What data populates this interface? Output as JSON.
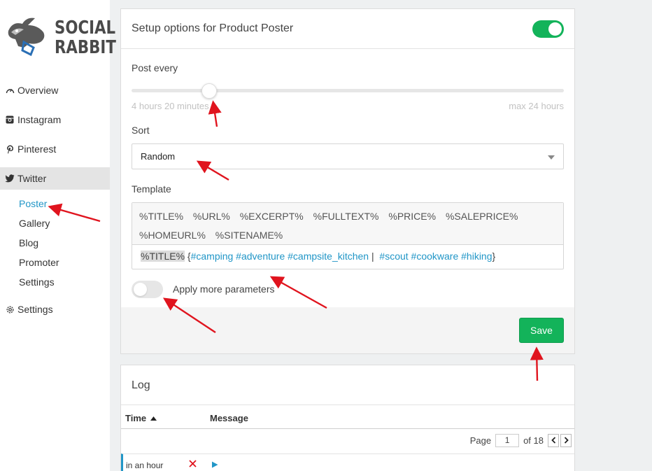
{
  "brand": {
    "line1": "SOCIAL",
    "line2": "RABBIT"
  },
  "sidebar": {
    "items": [
      {
        "label": "Overview",
        "icon": "dashboard-icon"
      },
      {
        "label": "Instagram",
        "icon": "instagram-icon"
      },
      {
        "label": "Pinterest",
        "icon": "pinterest-icon"
      },
      {
        "label": "Twitter",
        "icon": "twitter-icon"
      }
    ],
    "twitter_sub": [
      "Poster",
      "Gallery",
      "Blog",
      "Promoter",
      "Settings"
    ],
    "settings": {
      "label": "Settings",
      "icon": "gear-icon"
    }
  },
  "setup": {
    "title": "Setup options for Product Poster",
    "enabled": true,
    "post_every_label": "Post every",
    "post_every_value": "4 hours 20 minutes",
    "post_every_fraction": 0.18,
    "post_every_max": "max 24 hours",
    "sort_label": "Sort",
    "sort_value": "Random",
    "template_label": "Template",
    "tags": [
      "%TITLE%",
      "%URL%",
      "%EXCERPT%",
      "%FULLTEXT%",
      "%PRICE%",
      "%SALEPRICE%",
      "%HOMEURL%",
      "%SITENAME%"
    ],
    "template": {
      "title_token": "%TITLE%",
      "open_brace": "{",
      "hashtags1": "#camping #adventure #campsite_kitchen",
      "separator": "|",
      "hashtags2": "#scout #cookware #hiking",
      "close_brace": "}"
    },
    "more_params_label": "Apply more parameters",
    "more_params_enabled": false,
    "save_label": "Save"
  },
  "log": {
    "title": "Log",
    "col_time": "Time",
    "col_message": "Message",
    "page_label": "Page",
    "page_value": "1",
    "page_of": "of 18",
    "rows": [
      {
        "time": "in an hour"
      }
    ]
  },
  "colors": {
    "accent_green": "#13b35a",
    "accent_blue": "#2196c7",
    "annotation_red": "#e0141e"
  }
}
